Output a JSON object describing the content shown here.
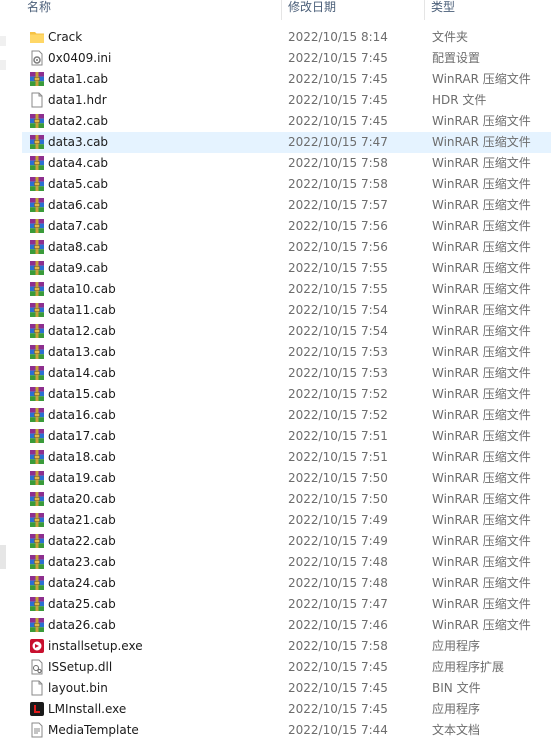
{
  "columns": {
    "name": "名称",
    "date": "修改日期",
    "type": "类型"
  },
  "colors": {
    "selected_row": "#e5f3ff",
    "header_text": "#4c607a",
    "secondary_text": "#6d6d6d"
  },
  "files": [
    {
      "name": "Crack",
      "date": "2022/10/15 8:14",
      "type": "文件夹",
      "icon": "folder-icon"
    },
    {
      "name": "0x0409.ini",
      "date": "2022/10/15 7:45",
      "type": "配置设置",
      "icon": "ini-file-icon"
    },
    {
      "name": "data1.cab",
      "date": "2022/10/15 7:45",
      "type": "WinRAR 压缩文件",
      "icon": "winrar-archive-icon"
    },
    {
      "name": "data1.hdr",
      "date": "2022/10/15 7:45",
      "type": "HDR 文件",
      "icon": "blank-file-icon"
    },
    {
      "name": "data2.cab",
      "date": "2022/10/15 7:45",
      "type": "WinRAR 压缩文件",
      "icon": "winrar-archive-icon"
    },
    {
      "name": "data3.cab",
      "date": "2022/10/15 7:47",
      "type": "WinRAR 压缩文件",
      "icon": "winrar-archive-icon",
      "selected": true
    },
    {
      "name": "data4.cab",
      "date": "2022/10/15 7:58",
      "type": "WinRAR 压缩文件",
      "icon": "winrar-archive-icon"
    },
    {
      "name": "data5.cab",
      "date": "2022/10/15 7:58",
      "type": "WinRAR 压缩文件",
      "icon": "winrar-archive-icon"
    },
    {
      "name": "data6.cab",
      "date": "2022/10/15 7:57",
      "type": "WinRAR 压缩文件",
      "icon": "winrar-archive-icon"
    },
    {
      "name": "data7.cab",
      "date": "2022/10/15 7:56",
      "type": "WinRAR 压缩文件",
      "icon": "winrar-archive-icon"
    },
    {
      "name": "data8.cab",
      "date": "2022/10/15 7:56",
      "type": "WinRAR 压缩文件",
      "icon": "winrar-archive-icon"
    },
    {
      "name": "data9.cab",
      "date": "2022/10/15 7:55",
      "type": "WinRAR 压缩文件",
      "icon": "winrar-archive-icon"
    },
    {
      "name": "data10.cab",
      "date": "2022/10/15 7:55",
      "type": "WinRAR 压缩文件",
      "icon": "winrar-archive-icon"
    },
    {
      "name": "data11.cab",
      "date": "2022/10/15 7:54",
      "type": "WinRAR 压缩文件",
      "icon": "winrar-archive-icon"
    },
    {
      "name": "data12.cab",
      "date": "2022/10/15 7:54",
      "type": "WinRAR 压缩文件",
      "icon": "winrar-archive-icon"
    },
    {
      "name": "data13.cab",
      "date": "2022/10/15 7:53",
      "type": "WinRAR 压缩文件",
      "icon": "winrar-archive-icon"
    },
    {
      "name": "data14.cab",
      "date": "2022/10/15 7:53",
      "type": "WinRAR 压缩文件",
      "icon": "winrar-archive-icon"
    },
    {
      "name": "data15.cab",
      "date": "2022/10/15 7:52",
      "type": "WinRAR 压缩文件",
      "icon": "winrar-archive-icon"
    },
    {
      "name": "data16.cab",
      "date": "2022/10/15 7:52",
      "type": "WinRAR 压缩文件",
      "icon": "winrar-archive-icon"
    },
    {
      "name": "data17.cab",
      "date": "2022/10/15 7:51",
      "type": "WinRAR 压缩文件",
      "icon": "winrar-archive-icon"
    },
    {
      "name": "data18.cab",
      "date": "2022/10/15 7:51",
      "type": "WinRAR 压缩文件",
      "icon": "winrar-archive-icon"
    },
    {
      "name": "data19.cab",
      "date": "2022/10/15 7:50",
      "type": "WinRAR 压缩文件",
      "icon": "winrar-archive-icon"
    },
    {
      "name": "data20.cab",
      "date": "2022/10/15 7:50",
      "type": "WinRAR 压缩文件",
      "icon": "winrar-archive-icon"
    },
    {
      "name": "data21.cab",
      "date": "2022/10/15 7:49",
      "type": "WinRAR 压缩文件",
      "icon": "winrar-archive-icon"
    },
    {
      "name": "data22.cab",
      "date": "2022/10/15 7:49",
      "type": "WinRAR 压缩文件",
      "icon": "winrar-archive-icon"
    },
    {
      "name": "data23.cab",
      "date": "2022/10/15 7:48",
      "type": "WinRAR 压缩文件",
      "icon": "winrar-archive-icon"
    },
    {
      "name": "data24.cab",
      "date": "2022/10/15 7:48",
      "type": "WinRAR 压缩文件",
      "icon": "winrar-archive-icon"
    },
    {
      "name": "data25.cab",
      "date": "2022/10/15 7:47",
      "type": "WinRAR 压缩文件",
      "icon": "winrar-archive-icon"
    },
    {
      "name": "data26.cab",
      "date": "2022/10/15 7:46",
      "type": "WinRAR 压缩文件",
      "icon": "winrar-archive-icon"
    },
    {
      "name": "installsetup.exe",
      "date": "2022/10/15 7:58",
      "type": "应用程序",
      "icon": "installer-app-icon"
    },
    {
      "name": "ISSetup.dll",
      "date": "2022/10/15 7:45",
      "type": "应用程序扩展",
      "icon": "dll-file-icon"
    },
    {
      "name": "layout.bin",
      "date": "2022/10/15 7:45",
      "type": "BIN 文件",
      "icon": "blank-file-icon"
    },
    {
      "name": "LMInstall.exe",
      "date": "2022/10/15 7:45",
      "type": "应用程序",
      "icon": "lminstall-app-icon"
    },
    {
      "name": "MediaTemplate",
      "date": "2022/10/15 7:44",
      "type": "文本文档",
      "icon": "text-file-icon",
      "partial": true
    }
  ]
}
